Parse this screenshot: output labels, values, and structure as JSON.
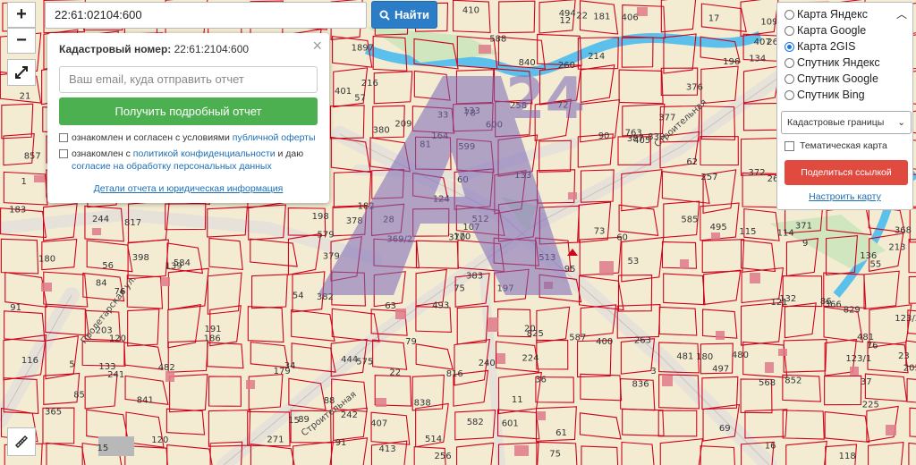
{
  "search": {
    "value": "22:61:02104:600",
    "button_label": "Найти"
  },
  "zoom": {
    "in_label": "+",
    "out_label": "−"
  },
  "popup": {
    "title_label": "Кадастровый номер:",
    "title_value": "22:61:2104:600",
    "email_placeholder": "Ваш email, куда отправить отчет",
    "report_button": "Получить подробный отчет",
    "consent1_text": "ознакомлен и согласен с условиями ",
    "consent1_link": "публичной оферты",
    "consent2_text": "ознакомлен с ",
    "consent2_link": "политикой конфиденциальности",
    "consent2_mid": " и даю ",
    "consent2_link2": "согласие на обработку персональных данных",
    "details_link": "Детали отчета и юридическая информация",
    "close_glyph": "×"
  },
  "layers": {
    "options": [
      "Карта Яндекс",
      "Карта Google",
      "Карта 2GIS",
      "Спутник Яндекс",
      "Спутник Google",
      "Спутник Bing"
    ],
    "selected_index": 2,
    "select_value": "Кадастровые границы",
    "thematic_label": "Тематическая карта",
    "share_button": "Поделиться ссылкой",
    "setup_link": "Настроить карту"
  },
  "map": {
    "street_labels": [
      "Пролетарская ул.",
      "Строительная",
      "Строительная"
    ],
    "watermark": "24",
    "parcel_numbers": [
      "183",
      "512",
      "164",
      "191",
      "36",
      "1897",
      "186",
      "513",
      "33",
      "34",
      "21",
      "20",
      "1",
      "9",
      "84",
      "3",
      "482",
      "481",
      "205",
      "209",
      "12",
      "37",
      "88",
      "91",
      "136",
      "60",
      "118",
      "22",
      "133",
      "134",
      "379",
      "378",
      "139",
      "601",
      "15",
      "23",
      "133",
      "132",
      "599",
      "600",
      "55",
      "120",
      "387",
      "372",
      "371",
      "78",
      "133",
      "62",
      "180",
      "179",
      "54",
      "368",
      "376",
      "73",
      "75",
      "81",
      "370",
      "76",
      "115",
      "258",
      "257",
      "56",
      "57",
      "582",
      "216",
      "568",
      "377",
      "15",
      "53",
      "369/2",
      "79",
      "116",
      "17",
      "495",
      "494",
      "16",
      "256",
      "585",
      "584",
      "75",
      "514",
      "407",
      "825",
      "114",
      "401",
      "366",
      "398",
      "382",
      "109",
      "11",
      "480",
      "481",
      "203",
      "261",
      "579",
      "240",
      "213",
      "225",
      "242",
      "493",
      "836",
      "841",
      "857",
      "123/2",
      "123/1",
      "410",
      "383",
      "107",
      "196",
      "365",
      "407",
      "124",
      "271",
      "260",
      "197",
      "214",
      "241",
      "406",
      "60",
      "61",
      "120",
      "852",
      "840",
      "413",
      "400",
      "90",
      "91",
      "95",
      "170",
      "405",
      "575",
      "244",
      "587",
      "224",
      "198",
      "817",
      "816",
      "28",
      "263",
      "262",
      "89",
      "85",
      "5",
      "182",
      "181",
      "588",
      "763",
      "63",
      "121",
      "444",
      "76",
      "829",
      "830",
      "22",
      "180",
      "497",
      "380",
      "86",
      "838",
      "69",
      "72"
    ],
    "accent_red": "#d0021b",
    "river_color": "#5bc0eb",
    "land_color": "#f3ecd2"
  }
}
